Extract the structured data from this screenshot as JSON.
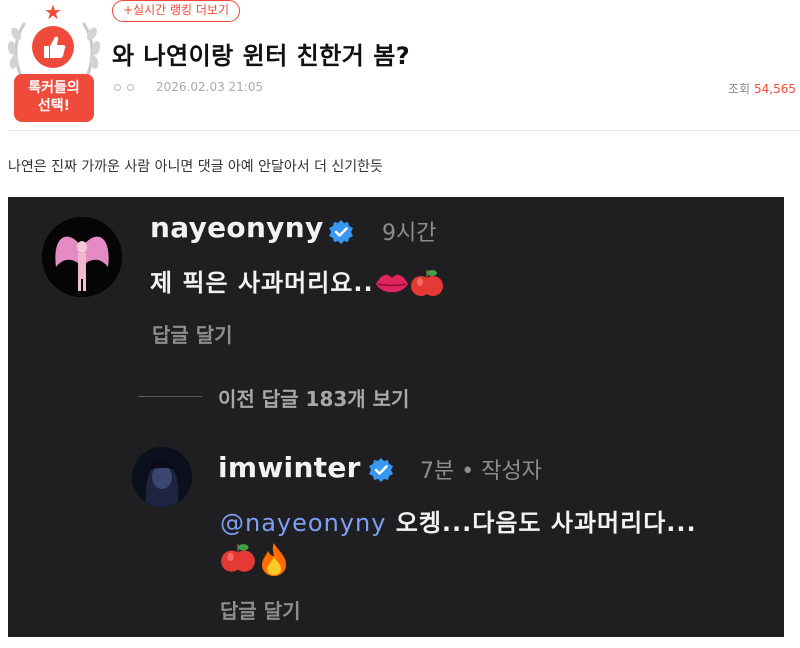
{
  "badge": {
    "label_line1": "톡커들의",
    "label_line2": "선택!"
  },
  "ranking_link": "+실시간 랭킹 더보기",
  "post": {
    "title": "와 나연이랑 윈터 친한거 봄?",
    "date": "2026.02.03 21:05",
    "views_label": "조회",
    "views_count": "54,565",
    "body": "나연은 진짜 가까운 사람 아니면 댓글 아예 안달아서 더 신기한듯"
  },
  "embed": {
    "comment1": {
      "username": "nayeonyny",
      "time": "9시간",
      "text": "제 픽은 사과머리요..",
      "reply_label": "답글 달기"
    },
    "previous_replies": "이전 답글 183개 보기",
    "comment2": {
      "username": "imwinter",
      "time": "7분 • 작성자",
      "mention": "@nayeonyny",
      "text": " 오켕...다음도 사과머리다...",
      "reply_label": "답글 달기"
    }
  },
  "colors": {
    "accent": "#ef4a3a",
    "dark_bg": "#1f1f21",
    "mention": "#7f9ef5",
    "verified": "#3897f0"
  }
}
